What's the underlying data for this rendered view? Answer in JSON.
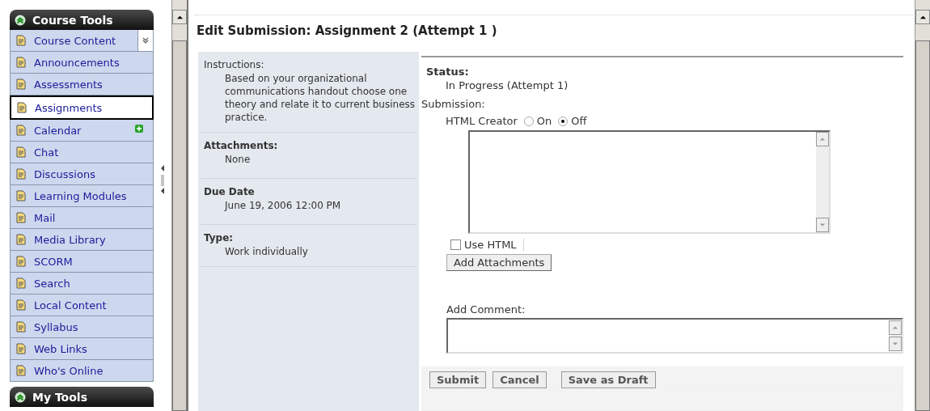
{
  "sidebar": {
    "title": "Course Tools",
    "items": [
      {
        "label": "Course Content",
        "selected": false,
        "kind": "menu"
      },
      {
        "label": "Announcements",
        "selected": false
      },
      {
        "label": "Assessments",
        "selected": false
      },
      {
        "label": "Assignments",
        "selected": true
      },
      {
        "label": "Calendar",
        "selected": false,
        "kind": "new"
      },
      {
        "label": "Chat",
        "selected": false
      },
      {
        "label": "Discussions",
        "selected": false
      },
      {
        "label": "Learning Modules",
        "selected": false
      },
      {
        "label": "Mail",
        "selected": false
      },
      {
        "label": "Media Library",
        "selected": false
      },
      {
        "label": "SCORM",
        "selected": false
      },
      {
        "label": "Search",
        "selected": false
      },
      {
        "label": "Local Content",
        "selected": false
      },
      {
        "label": "Syllabus",
        "selected": false
      },
      {
        "label": "Web Links",
        "selected": false
      },
      {
        "label": "Who's Online",
        "selected": false
      }
    ],
    "footer_title": "My Tools"
  },
  "page_title": "Edit Submission: Assignment 2 (Attempt 1 )",
  "details": [
    {
      "label": "Instructions:",
      "label_bold": false,
      "value": "Based on your organizational communications handout choose one theory and relate it to current business practice."
    },
    {
      "label": "Attachments:",
      "label_bold": true,
      "value": "None"
    },
    {
      "label": "Due Date",
      "label_bold": true,
      "value": "June 19, 2006 12:00 PM"
    },
    {
      "label": "Type:",
      "label_bold": true,
      "value": "Work individually"
    }
  ],
  "status": {
    "label": "Status:",
    "value": "In Progress (Attempt 1)"
  },
  "submission": {
    "label": "Submission:",
    "html_creator_label": "HTML Creator",
    "options": [
      {
        "label": "On",
        "selected": false
      },
      {
        "label": "Off",
        "selected": true
      }
    ],
    "use_html": {
      "label": "Use HTML",
      "checked": false
    },
    "attach_button": "Add Attachments"
  },
  "comment_label": "Add Comment:",
  "actions": [
    "Submit",
    "Cancel",
    "Save as Draft"
  ]
}
